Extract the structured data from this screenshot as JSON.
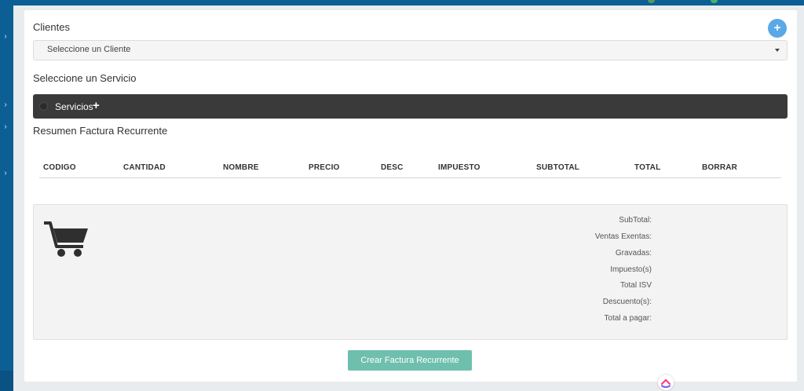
{
  "form": {
    "clients_label": "Clientes",
    "client_select_value": "Seleccione un Cliente",
    "add_client_icon": "plus-icon",
    "service_label": "Seleccione un Servicio",
    "services_button_label": "Servicios",
    "summary_title": "Resumen Factura Recurrente"
  },
  "table": {
    "columns": [
      "CODIGO",
      "CANTIDAD",
      "NOMBRE",
      "PRECIO",
      "DESC",
      "IMPUESTO",
      "SUBTOTAL",
      "TOTAL",
      "BORRAR"
    ],
    "rows": []
  },
  "summary": {
    "icon": "shopping-cart-icon",
    "labels": [
      "SubTotal:",
      "Ventas Exentas:",
      "Gravadas:",
      "Impuesto(s)",
      "Total ISV",
      "Descuento(s):",
      "Total a pagar:"
    ]
  },
  "actions": {
    "create_button_label": "Crear Factura Recurrente"
  },
  "colors": {
    "nav_blue": "#0b5f95",
    "add_button": "#5aa9e6",
    "services_bar": "#3a3a3a",
    "create_button": "#6fbfae"
  }
}
